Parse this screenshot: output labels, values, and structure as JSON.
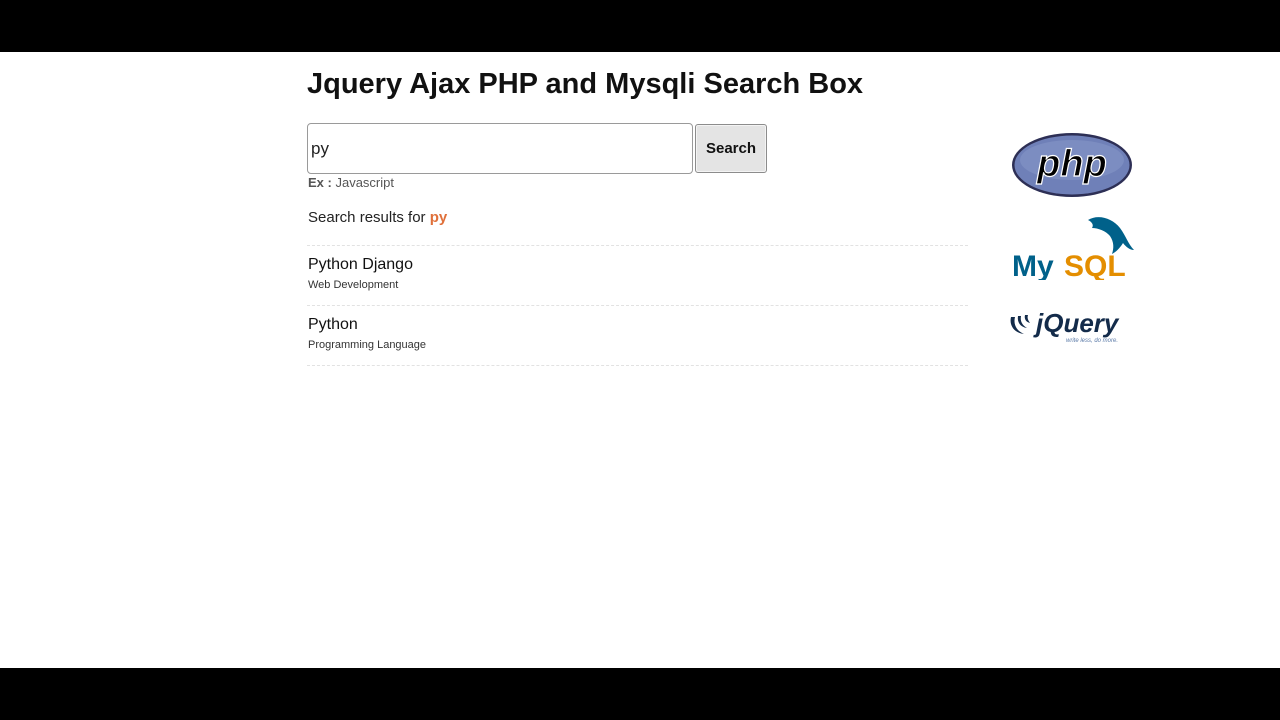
{
  "page": {
    "title": "Jquery Ajax PHP and Mysqli Search Box"
  },
  "search": {
    "value": "py",
    "placeholder": "",
    "button_label": "Search",
    "example_label": "Ex :",
    "example_value": "Javascript"
  },
  "results": {
    "heading_prefix": "Search results for",
    "query": "py",
    "items": [
      {
        "title": "Python Django",
        "subtitle": "Web Development"
      },
      {
        "title": "Python",
        "subtitle": "Programming Language"
      }
    ]
  },
  "logos": {
    "php_text": "php",
    "mysql_text_my": "My",
    "mysql_text_sql": "SQL",
    "jquery_text": "jQuery",
    "jquery_tagline": "write less, do more."
  },
  "colors": {
    "accent_query": "#e0703a",
    "php_blue": "#6f80b8",
    "mysql_blue": "#00618a",
    "mysql_orange": "#e48e00",
    "jquery_dark": "#132b4a"
  }
}
